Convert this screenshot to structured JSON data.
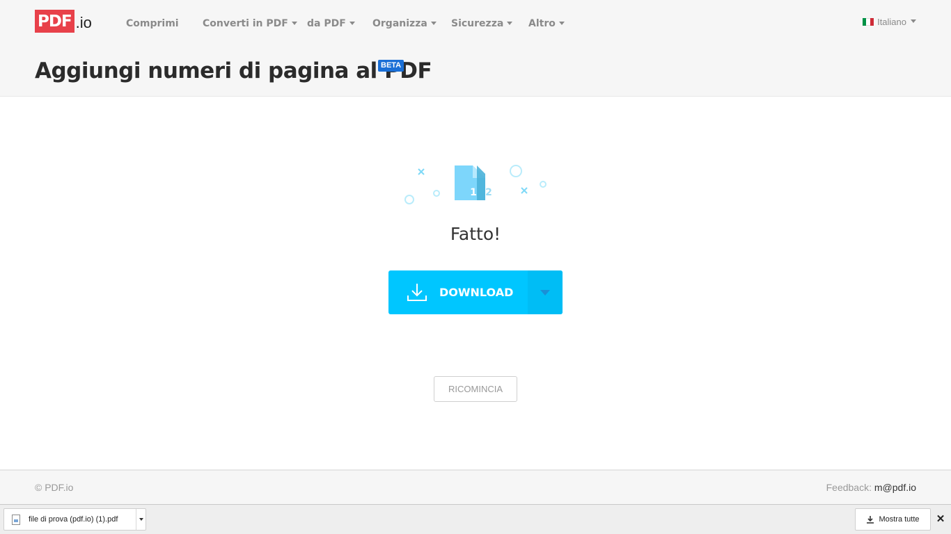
{
  "header": {
    "logo_mark": "PDF",
    "logo_suffix": ".io",
    "nav": [
      {
        "label": "Comprimi",
        "dropdown": false
      },
      {
        "label": "Converti in PDF",
        "dropdown": true
      },
      {
        "label": "da PDF",
        "dropdown": true
      },
      {
        "label": "Organizza",
        "dropdown": true
      },
      {
        "label": "Sicurezza",
        "dropdown": true
      },
      {
        "label": "Altro",
        "dropdown": true
      }
    ],
    "language": "Italiano",
    "page_title": "Aggiungi numeri di pagina al PDF",
    "badge": "BETA"
  },
  "main": {
    "illustration_numbers": [
      "1",
      "2"
    ],
    "status": "Fatto!",
    "download_label": "DOWNLOAD",
    "restart_label": "RICOMINCIA"
  },
  "footer": {
    "copyright": "© PDF.io",
    "feedback_label": "Feedback:",
    "feedback_email": "m@pdf.io"
  },
  "download_shelf": {
    "file_name": "file di prova (pdf.io) (1).pdf",
    "show_all_label": "Mostra tutte",
    "close_symbol": "✕"
  },
  "colors": {
    "brand_red": "#e8414a",
    "accent_cyan": "#00c6ff",
    "beta_blue": "#1a6fd6"
  }
}
